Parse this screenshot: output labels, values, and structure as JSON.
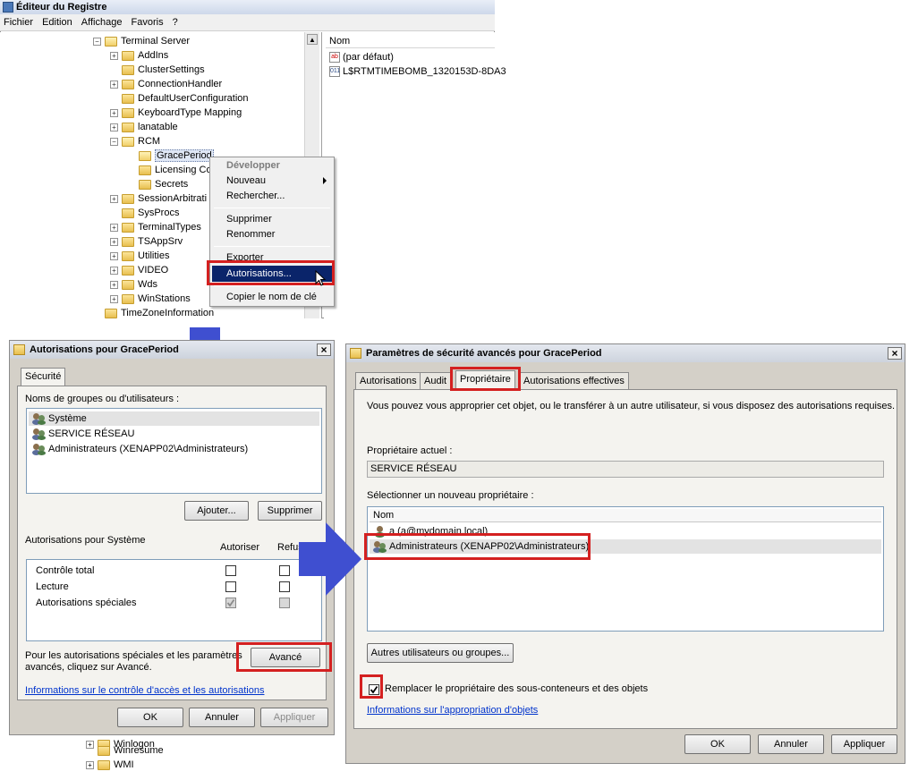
{
  "registry": {
    "title": "Éditeur du Registre",
    "menu": [
      "Fichier",
      "Edition",
      "Affichage",
      "Favoris",
      "?"
    ],
    "tree": [
      {
        "label": "Terminal Server",
        "expander": "−"
      },
      {
        "label": "AddIns",
        "expander": "+"
      },
      {
        "label": "ClusterSettings",
        "expander": ""
      },
      {
        "label": "ConnectionHandler",
        "expander": "+"
      },
      {
        "label": "DefaultUserConfiguration",
        "expander": ""
      },
      {
        "label": "KeyboardType Mapping",
        "expander": "+"
      },
      {
        "label": "lanatable",
        "expander": "+"
      },
      {
        "label": "RCM",
        "expander": "−"
      },
      {
        "label": "GracePeriod",
        "expander": ""
      },
      {
        "label": "Licensing Co",
        "expander": ""
      },
      {
        "label": "Secrets",
        "expander": ""
      },
      {
        "label": "SessionArbitrati",
        "expander": "+"
      },
      {
        "label": "SysProcs",
        "expander": ""
      },
      {
        "label": "TerminalTypes",
        "expander": "+"
      },
      {
        "label": "TSAppSrv",
        "expander": "+"
      },
      {
        "label": "Utilities",
        "expander": "+"
      },
      {
        "label": "VIDEO",
        "expander": "+"
      },
      {
        "label": "Wds",
        "expander": "+"
      },
      {
        "label": "WinStations",
        "expander": "+"
      },
      {
        "label": "TimeZoneInformation",
        "expander": ""
      }
    ],
    "values_header": "Nom",
    "values": [
      {
        "icon": "ab",
        "name": "(par défaut)"
      },
      {
        "icon": "011",
        "name": "L$RTMTIMEBOMB_1320153D-8DA3"
      }
    ],
    "lower_tree": [
      {
        "label": "Winlogon",
        "expander": "+"
      },
      {
        "label": "Winresume",
        "expander": ""
      },
      {
        "label": "WMI",
        "expander": "+"
      }
    ]
  },
  "context_menu": {
    "items": [
      "Développer",
      "Nouveau",
      "Rechercher...",
      "Supprimer",
      "Renommer",
      "Exporter",
      "Autorisations...",
      "Copier le nom de clé"
    ]
  },
  "perm_dialog": {
    "title": "Autorisations pour GracePeriod",
    "tab": "Sécurité",
    "groups_label": "Noms de groupes ou d'utilisateurs :",
    "groups": [
      "Système",
      "SERVICE RÉSEAU",
      "Administrateurs (XENAPP02\\Administrateurs)"
    ],
    "add_btn": "Ajouter...",
    "remove_btn": "Supprimer",
    "perms_for": "Autorisations pour Système",
    "col_allow": "Autoriser",
    "col_deny": "Refus",
    "perms": [
      {
        "name": "Contrôle total",
        "allow": false,
        "deny": false
      },
      {
        "name": "Lecture",
        "allow": false,
        "deny": false
      },
      {
        "name": "Autorisations spéciales",
        "allow": true,
        "deny": false
      }
    ],
    "advanced_text_1": "Pour les autorisations spéciales et les paramètres",
    "advanced_text_2": "avancés, cliquez sur Avancé.",
    "advanced_btn": "Avancé",
    "link": "Informations sur le contrôle d'accès et les autorisations",
    "ok": "OK",
    "cancel": "Annuler",
    "apply": "Appliquer"
  },
  "adv_dialog": {
    "title": "Paramètres de sécurité avancés pour GracePeriod",
    "tabs": [
      "Autorisations",
      "Audit",
      "Propriétaire",
      "Autorisations effectives"
    ],
    "info": "Vous pouvez vous approprier cet objet, ou le transférer à un autre utilisateur, si vous disposez des autorisations requises.",
    "current_owner_label": "Propriétaire actuel :",
    "current_owner": "SERVICE RÉSEAU",
    "new_owner_label": "Sélectionner un nouveau propriétaire :",
    "list_header": "Nom",
    "owners": [
      "a (a@mydomain.local)",
      "Administrateurs (XENAPP02\\Administrateurs)"
    ],
    "other_btn": "Autres utilisateurs ou groupes...",
    "replace_checked": true,
    "replace_label": "Remplacer le propriétaire des sous-conteneurs et des objets",
    "link": "Informations sur l'appropriation d'objets",
    "ok": "OK",
    "cancel": "Annuler",
    "apply": "Appliquer"
  },
  "colors": {
    "highlight_red": "#d42020",
    "arrow_blue": "#3f4fd0",
    "menu_selection": "#0a246a",
    "link": "#0033cc"
  }
}
